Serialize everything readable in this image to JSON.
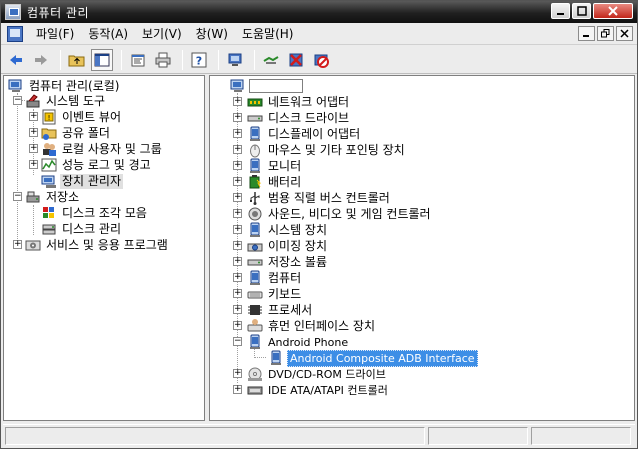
{
  "window": {
    "title": "컴퓨터 관리"
  },
  "menu": {
    "items": [
      {
        "label": "파일(F)"
      },
      {
        "label": "동작(A)"
      },
      {
        "label": "보기(V)"
      },
      {
        "label": "창(W)"
      },
      {
        "label": "도움말(H)"
      }
    ]
  },
  "toolbar": {
    "icons": [
      "back-arrow-icon",
      "forward-arrow-icon",
      "up-folder-icon",
      "show-hide-tree-icon",
      "properties-icon",
      "print-icon",
      "help-icon",
      "scan-hardware-icon",
      "uninstall-icon",
      "disable-device-icon",
      "update-driver-icon"
    ]
  },
  "left_tree": {
    "root": "컴퓨터 관리(로컬)",
    "system_tools": "시스템 도구",
    "event_viewer": "이벤트 뷰어",
    "shared_folders": "공유 폴더",
    "local_users": "로컬 사용자 및 그룹",
    "perf_logs": "성능 로그 및 경고",
    "device_manager": "장치 관리자",
    "storage": "저장소",
    "defrag": "디스크 조각 모음",
    "disk_mgmt": "디스크 관리",
    "services": "서비스 및 응용 프로그램"
  },
  "device_tree": {
    "computer_name": "",
    "categories": [
      {
        "label": "네트워크 어댑터",
        "icon": "network-adapter-icon"
      },
      {
        "label": "디스크 드라이브",
        "icon": "disk-drive-icon"
      },
      {
        "label": "디스플레이 어댑터",
        "icon": "display-adapter-icon"
      },
      {
        "label": "마우스 및 기타 포인팅 장치",
        "icon": "mouse-icon"
      },
      {
        "label": "모니터",
        "icon": "monitor-icon"
      },
      {
        "label": "배터리",
        "icon": "battery-icon"
      },
      {
        "label": "범용 직렬 버스 컨트롤러",
        "icon": "usb-icon"
      },
      {
        "label": "사운드, 비디오 및 게임 컨트롤러",
        "icon": "sound-icon"
      },
      {
        "label": "시스템 장치",
        "icon": "system-device-icon"
      },
      {
        "label": "이미징 장치",
        "icon": "imaging-device-icon"
      },
      {
        "label": "저장소 볼륨",
        "icon": "storage-volume-icon"
      },
      {
        "label": "컴퓨터",
        "icon": "computer-icon"
      },
      {
        "label": "키보드",
        "icon": "keyboard-icon"
      },
      {
        "label": "프로세서",
        "icon": "processor-icon"
      },
      {
        "label": "휴먼 인터페이스 장치",
        "icon": "hid-icon"
      }
    ],
    "android_phone": "Android Phone",
    "android_adb": "Android Composite ADB Interface",
    "dvd": "DVD/CD-ROM 드라이브",
    "ide": "IDE ATA/ATAPI 컨트롤러"
  }
}
